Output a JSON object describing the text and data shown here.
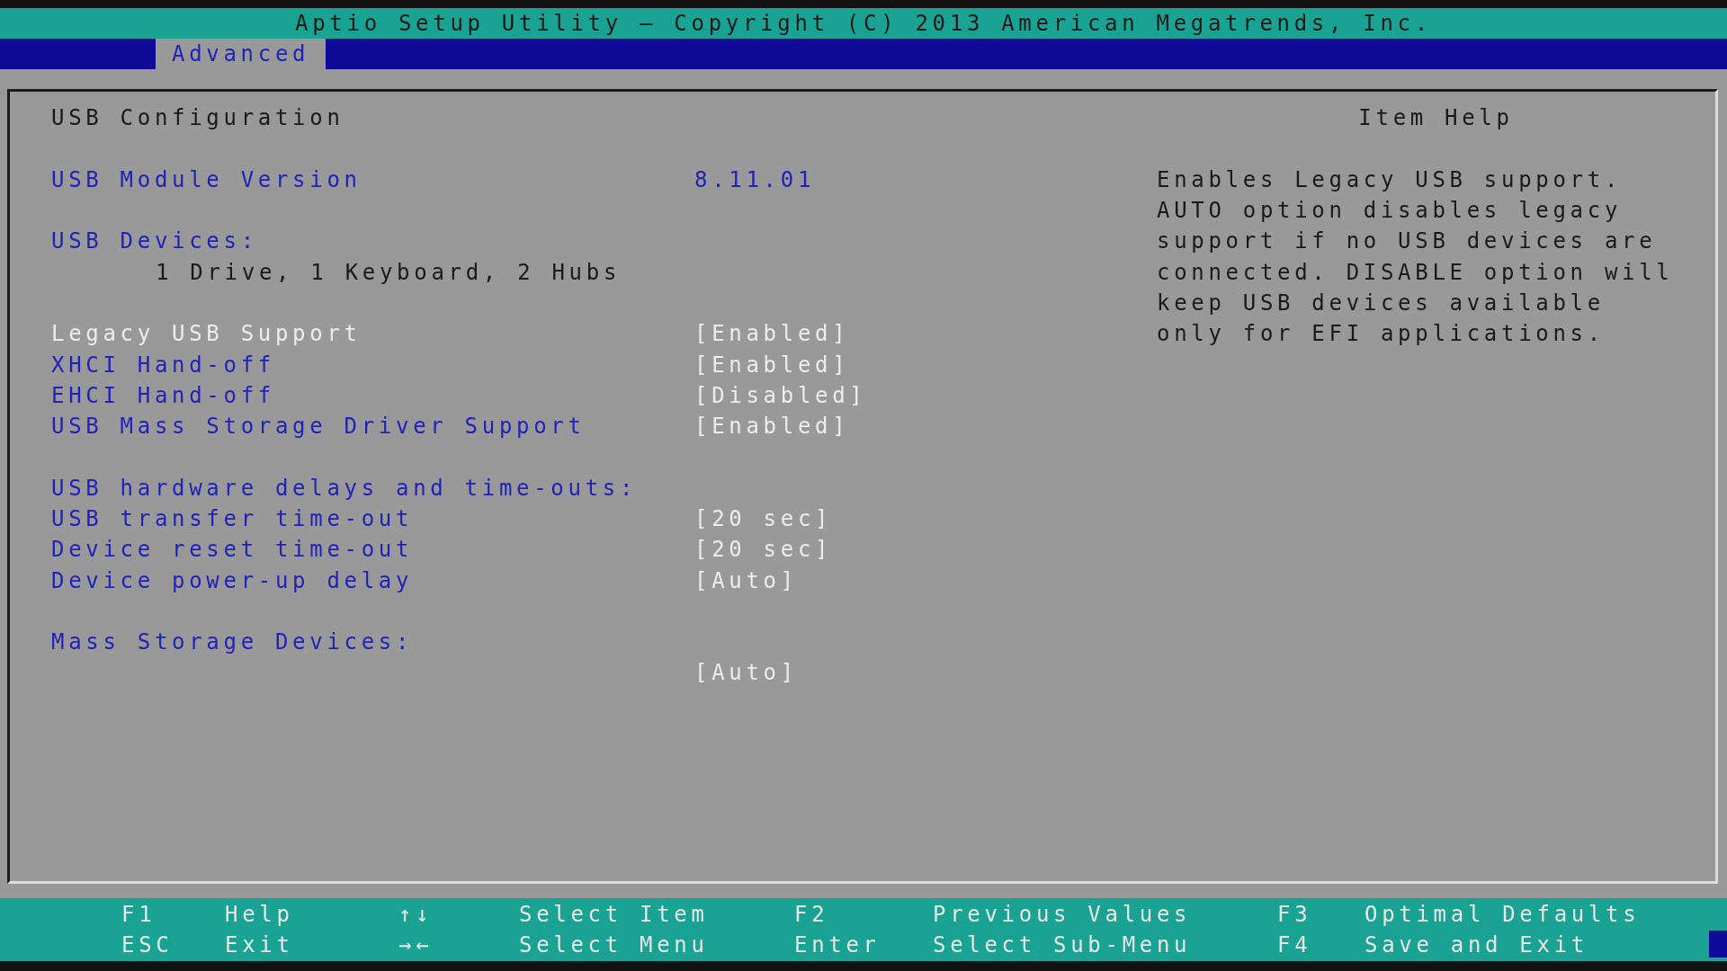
{
  "window": {
    "title": "Aptio Setup Utility – Copyright (C) 2013 American Megatrends, Inc."
  },
  "tabs": [
    {
      "label": "Advanced",
      "selected": true
    }
  ],
  "panel": {
    "title": "USB Configuration",
    "rows": [
      {
        "kind": "info",
        "label": "USB Module Version",
        "value": "8.11.01"
      },
      {
        "kind": "gap"
      },
      {
        "kind": "subheading",
        "label": "USB Devices:"
      },
      {
        "kind": "text",
        "label": "1 Drive, 1 Keyboard, 2 Hubs"
      },
      {
        "kind": "gap"
      },
      {
        "kind": "setting",
        "label": "Legacy USB Support",
        "value": "[Enabled]",
        "selected": true
      },
      {
        "kind": "setting",
        "label": "XHCI Hand-off",
        "value": "[Enabled]",
        "selected": false
      },
      {
        "kind": "setting",
        "label": "EHCI Hand-off",
        "value": "[Disabled]",
        "selected": false
      },
      {
        "kind": "setting",
        "label": "USB Mass Storage Driver Support",
        "value": "[Enabled]",
        "selected": false
      },
      {
        "kind": "gap"
      },
      {
        "kind": "subheading",
        "label": "USB hardware delays and time-outs:"
      },
      {
        "kind": "setting",
        "label": "USB transfer time-out",
        "value": "[20 sec]",
        "selected": false
      },
      {
        "kind": "setting",
        "label": "Device reset time-out",
        "value": "[20 sec]",
        "selected": false
      },
      {
        "kind": "setting",
        "label": "Device power-up delay",
        "value": "[Auto]",
        "selected": false
      },
      {
        "kind": "gap"
      },
      {
        "kind": "subheading",
        "label": "Mass Storage Devices:"
      },
      {
        "kind": "setting",
        "value": "[Auto]"
      }
    ]
  },
  "help": {
    "title": "Item Help",
    "lines": [
      "Enables Legacy USB support.",
      "AUTO option disables legacy",
      "support if no USB devices are",
      "connected. DISABLE option will",
      "keep USB devices available",
      "only for EFI applications."
    ]
  },
  "keys": [
    {
      "key": "F1",
      "action": "Help"
    },
    {
      "key": "↑↓",
      "action": "Select Item"
    },
    {
      "key": "F2",
      "action": "Previous Values"
    },
    {
      "key": "F3",
      "action": "Optimal Defaults"
    },
    {
      "key": "ESC",
      "action": "Exit"
    },
    {
      "key": "→←",
      "action": "Select Menu"
    },
    {
      "key": "Enter",
      "action": "Select Sub-Menu"
    },
    {
      "key": "F4",
      "action": "Save and Exit"
    }
  ]
}
